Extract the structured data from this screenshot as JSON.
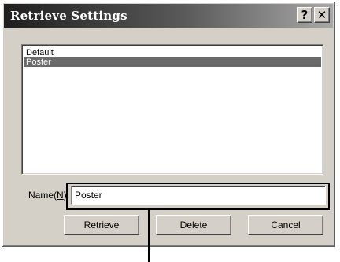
{
  "window": {
    "title": "Retrieve Settings",
    "help_glyph": "?",
    "close_glyph": "✕"
  },
  "settings_list": {
    "items": [
      {
        "label": "Default",
        "selected": false
      },
      {
        "label": "Poster",
        "selected": true
      }
    ]
  },
  "name_field": {
    "label_prefix": "Name(",
    "label_mnemonic": "N",
    "label_suffix": ")",
    "value": "Poster"
  },
  "buttons": {
    "retrieve": "Retrieve",
    "delete": "Delete",
    "cancel": "Cancel"
  },
  "colors": {
    "selection": "#6a6a6a",
    "dialog_face": "#d4d0c8",
    "callout": "#000000"
  },
  "icons": {
    "help": "help-icon",
    "close": "close-icon"
  }
}
